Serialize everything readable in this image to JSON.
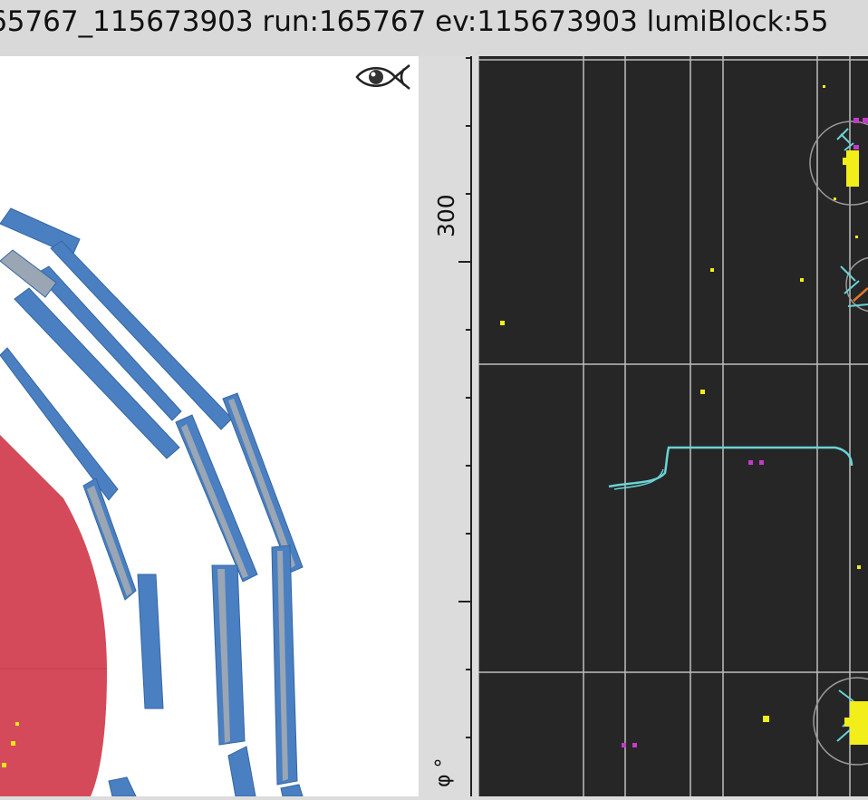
{
  "window": {
    "title": "65767_115673903 run:165767 ev:115673903 lumiBlock:55"
  },
  "left_view": {
    "icon": "eye-fish-icon",
    "colors": {
      "background": "#ffffff",
      "calorimeter": "#d44a5a",
      "muon_chamber": "#4a7fc1",
      "muon_chamber_dark": "#3566a3",
      "muon_chamber_grey": "#9aa6b4",
      "hit": "#f2e61a"
    }
  },
  "axis": {
    "tick_label": "300",
    "title": "φ °"
  },
  "right_view": {
    "colors": {
      "background": "#262626",
      "grid": "#bdbdbd",
      "track": "#6ad3d6",
      "hit_yellow": "#f2ee1a",
      "hit_magenta": "#c23bc9",
      "jet_circle": "#9a9a9a",
      "orange": "#e0782a"
    }
  }
}
